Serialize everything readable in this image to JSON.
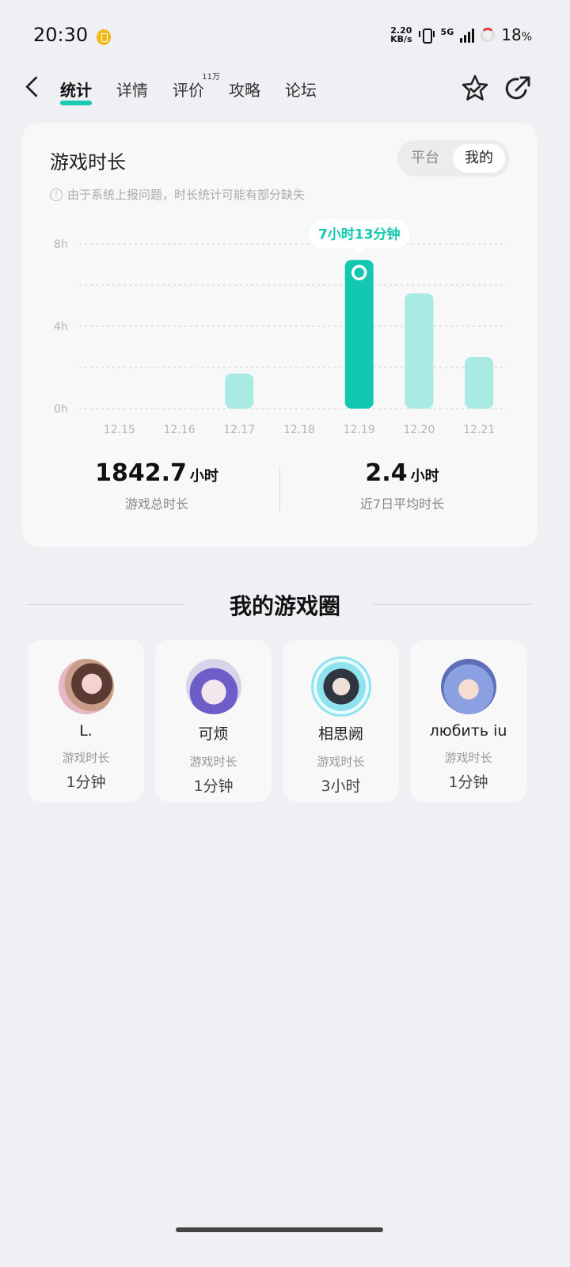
{
  "status": {
    "time": "20:30",
    "net_speed_top": "2.20",
    "net_speed_bottom": "KB/s",
    "network": "5G",
    "battery": "18",
    "battery_unit": "%"
  },
  "nav": {
    "tabs": [
      {
        "label": "统计",
        "active": true
      },
      {
        "label": "详情"
      },
      {
        "label": "评价",
        "badge": "11万"
      },
      {
        "label": "攻略"
      },
      {
        "label": "论坛"
      }
    ]
  },
  "play": {
    "title": "游戏时长",
    "toggle": [
      "平台",
      "我的"
    ],
    "notice": "由于系统上报问题，时长统计可能有部分缺失",
    "tooltip": "7小时13分钟",
    "total_value": "1842.7",
    "total_unit": "小时",
    "total_label": "游戏总时长",
    "avg_value": "2.4",
    "avg_unit": "小时",
    "avg_label": "近7日平均时长"
  },
  "chart_data": {
    "type": "bar",
    "categories": [
      "12.15",
      "12.16",
      "12.17",
      "12.18",
      "12.19",
      "12.20",
      "12.21"
    ],
    "values": [
      0,
      0,
      1.7,
      0,
      7.22,
      5.6,
      2.5
    ],
    "highlight_index": 4,
    "y_ticks": [
      "0h",
      "4h",
      "8h"
    ],
    "ylim": [
      0,
      8
    ],
    "grid": true,
    "colors": {
      "highlight": "#13c8b0",
      "normal": "#a9ebe3"
    }
  },
  "circle": {
    "title": "我的游戏圈",
    "friends": [
      {
        "name": "L.",
        "label": "游戏时长",
        "value": "1分钟"
      },
      {
        "name": "可烦",
        "label": "游戏时长",
        "value": "1分钟"
      },
      {
        "name": "相思阙",
        "label": "游戏时长",
        "value": "3小时"
      },
      {
        "name": "любить iu",
        "label": "游戏时长",
        "value": "1分钟"
      }
    ]
  }
}
